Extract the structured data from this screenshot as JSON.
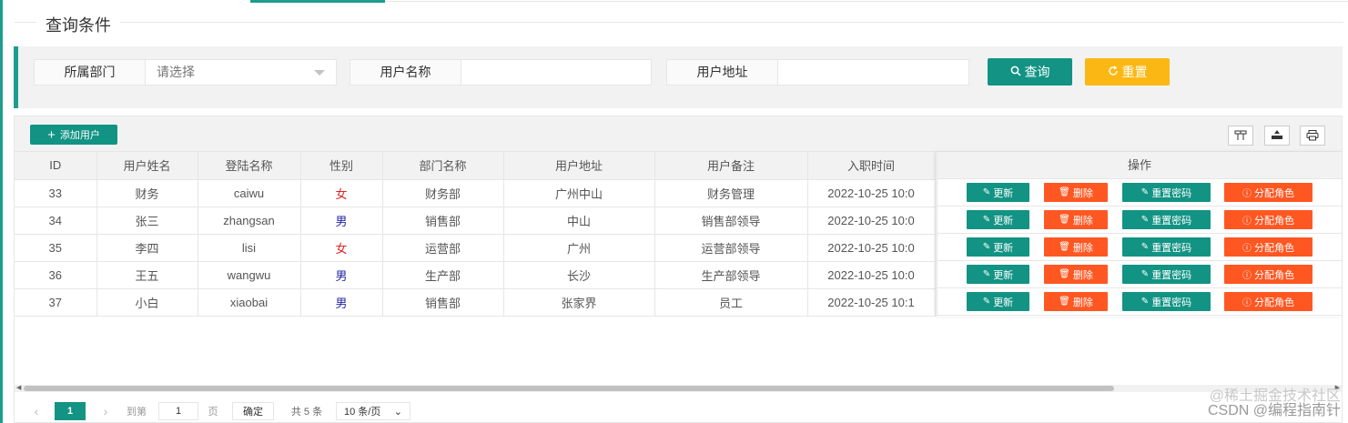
{
  "fieldset": {
    "title": "查询条件"
  },
  "search": {
    "dept_label": "所属部门",
    "dept_placeholder": "请选择",
    "name_label": "用户名称",
    "name_value": "",
    "address_label": "用户地址",
    "address_value": "",
    "query_label": "查询",
    "reset_label": "重置"
  },
  "toolbar": {
    "add_label": "添加用户",
    "icons": [
      "columns-icon",
      "export-icon",
      "print-icon"
    ]
  },
  "table": {
    "columns": [
      "ID",
      "用户姓名",
      "登陆名称",
      "性别",
      "部门名称",
      "用户地址",
      "用户备注",
      "入职时间",
      "操作"
    ],
    "rows": [
      {
        "id": "33",
        "name": "财务",
        "login": "caiwu",
        "gender": "女",
        "dept": "财务部",
        "address": "广州中山",
        "remark": "财务管理",
        "time": "2022-10-25 10:0"
      },
      {
        "id": "34",
        "name": "张三",
        "login": "zhangsan",
        "gender": "男",
        "dept": "销售部",
        "address": "中山",
        "remark": "销售部领导",
        "time": "2022-10-25 10:0"
      },
      {
        "id": "35",
        "name": "李四",
        "login": "lisi",
        "gender": "女",
        "dept": "运营部",
        "address": "广州",
        "remark": "运营部领导",
        "time": "2022-10-25 10:0"
      },
      {
        "id": "36",
        "name": "王五",
        "login": "wangwu",
        "gender": "男",
        "dept": "生产部",
        "address": "长沙",
        "remark": "生产部领导",
        "time": "2022-10-25 10:0"
      },
      {
        "id": "37",
        "name": "小白",
        "login": "xiaobai",
        "gender": "男",
        "dept": "销售部",
        "address": "张家界",
        "remark": "员工",
        "time": "2022-10-25 10:1"
      }
    ],
    "actions": {
      "update": "更新",
      "delete": "删除",
      "reset_pwd": "重置密码",
      "assign_role": "分配角色"
    }
  },
  "pager": {
    "current": "1",
    "goto_label": "到第",
    "goto_value": "1",
    "page_unit": "页",
    "confirm_label": "确定",
    "total": "共 5 条",
    "page_size": "10 条/页"
  },
  "watermark": {
    "line1": "@稀土掘金技术社区",
    "line2": "CSDN @编程指南针"
  },
  "colors": {
    "primary": "#129384",
    "warm": "#fbb814",
    "danger": "#ff5722",
    "female": "#e02424",
    "male": "#2323a8"
  }
}
